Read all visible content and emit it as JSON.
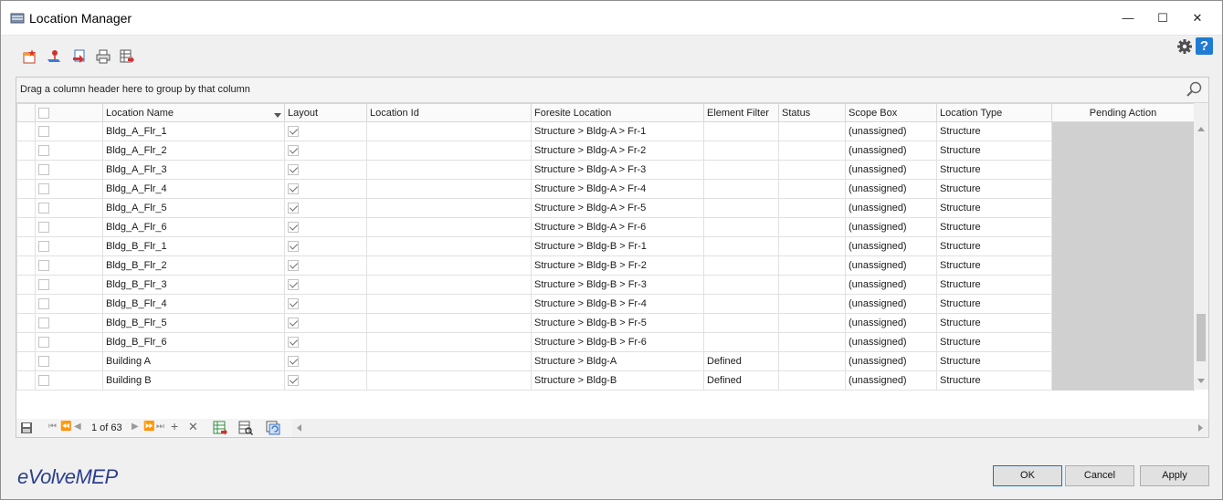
{
  "window": {
    "title": "Location Manager",
    "minimize_glyph": "—",
    "maximize_glyph": "☐",
    "close_glyph": "✕"
  },
  "toolbar": {
    "icons": [
      "new-location-icon",
      "edit-location-icon",
      "import-icon",
      "print-icon",
      "export-icon"
    ]
  },
  "group_panel": {
    "text": "Drag a column header here to group by that column"
  },
  "grid": {
    "columns": [
      "",
      "",
      "Location Name",
      "Layout",
      "Location Id",
      "Foresite Location",
      "Element Filter",
      "Status",
      "Scope Box",
      "Location Type",
      "Pending Action"
    ],
    "rows": [
      {
        "name": "Bldg_A_Flr_1",
        "layout": true,
        "location_id": "",
        "foresite": "Structure > Bldg-A > Fr-1",
        "filter": "",
        "status": "",
        "scope": "(unassigned)",
        "type": "Structure"
      },
      {
        "name": "Bldg_A_Flr_2",
        "layout": true,
        "location_id": "",
        "foresite": "Structure > Bldg-A > Fr-2",
        "filter": "",
        "status": "",
        "scope": "(unassigned)",
        "type": "Structure"
      },
      {
        "name": "Bldg_A_Flr_3",
        "layout": true,
        "location_id": "",
        "foresite": "Structure > Bldg-A > Fr-3",
        "filter": "",
        "status": "",
        "scope": "(unassigned)",
        "type": "Structure"
      },
      {
        "name": "Bldg_A_Flr_4",
        "layout": true,
        "location_id": "",
        "foresite": "Structure > Bldg-A > Fr-4",
        "filter": "",
        "status": "",
        "scope": "(unassigned)",
        "type": "Structure"
      },
      {
        "name": "Bldg_A_Flr_5",
        "layout": true,
        "location_id": "",
        "foresite": "Structure > Bldg-A > Fr-5",
        "filter": "",
        "status": "",
        "scope": "(unassigned)",
        "type": "Structure"
      },
      {
        "name": "Bldg_A_Flr_6",
        "layout": true,
        "location_id": "",
        "foresite": "Structure > Bldg-A > Fr-6",
        "filter": "",
        "status": "",
        "scope": "(unassigned)",
        "type": "Structure"
      },
      {
        "name": "Bldg_B_Flr_1",
        "layout": true,
        "location_id": "",
        "foresite": "Structure > Bldg-B > Fr-1",
        "filter": "",
        "status": "",
        "scope": "(unassigned)",
        "type": "Structure"
      },
      {
        "name": "Bldg_B_Flr_2",
        "layout": true,
        "location_id": "",
        "foresite": "Structure > Bldg-B > Fr-2",
        "filter": "",
        "status": "",
        "scope": "(unassigned)",
        "type": "Structure"
      },
      {
        "name": "Bldg_B_Flr_3",
        "layout": true,
        "location_id": "",
        "foresite": "Structure > Bldg-B > Fr-3",
        "filter": "",
        "status": "",
        "scope": "(unassigned)",
        "type": "Structure"
      },
      {
        "name": "Bldg_B_Flr_4",
        "layout": true,
        "location_id": "",
        "foresite": "Structure > Bldg-B > Fr-4",
        "filter": "",
        "status": "",
        "scope": "(unassigned)",
        "type": "Structure"
      },
      {
        "name": "Bldg_B_Flr_5",
        "layout": true,
        "location_id": "",
        "foresite": "Structure > Bldg-B > Fr-5",
        "filter": "",
        "status": "",
        "scope": "(unassigned)",
        "type": "Structure"
      },
      {
        "name": "Bldg_B_Flr_6",
        "layout": true,
        "location_id": "",
        "foresite": "Structure > Bldg-B > Fr-6",
        "filter": "",
        "status": "",
        "scope": "(unassigned)",
        "type": "Structure"
      },
      {
        "name": "Building A",
        "layout": true,
        "location_id": "",
        "foresite": "Structure > Bldg-A",
        "filter": "Defined",
        "status": "",
        "scope": "(unassigned)",
        "type": "Structure"
      },
      {
        "name": "Building B",
        "layout": true,
        "location_id": "",
        "foresite": "Structure > Bldg-B",
        "filter": "Defined",
        "status": "",
        "scope": "(unassigned)",
        "type": "Structure"
      }
    ]
  },
  "navigator": {
    "page_text": "1 of 63",
    "glyphs": [
      "⏮",
      "⏪",
      "◀",
      "▶",
      "⏩",
      "⏭",
      "+",
      "✕"
    ]
  },
  "footer": {
    "logo_text": "eVolveMEP",
    "ok_label": "OK",
    "cancel_label": "Cancel",
    "apply_label": "Apply"
  },
  "colors": {
    "accent": "#0078d7",
    "help": "#1f7bd4",
    "logo": "#2b3f8e",
    "pending_cell": "#d0d0d0"
  }
}
